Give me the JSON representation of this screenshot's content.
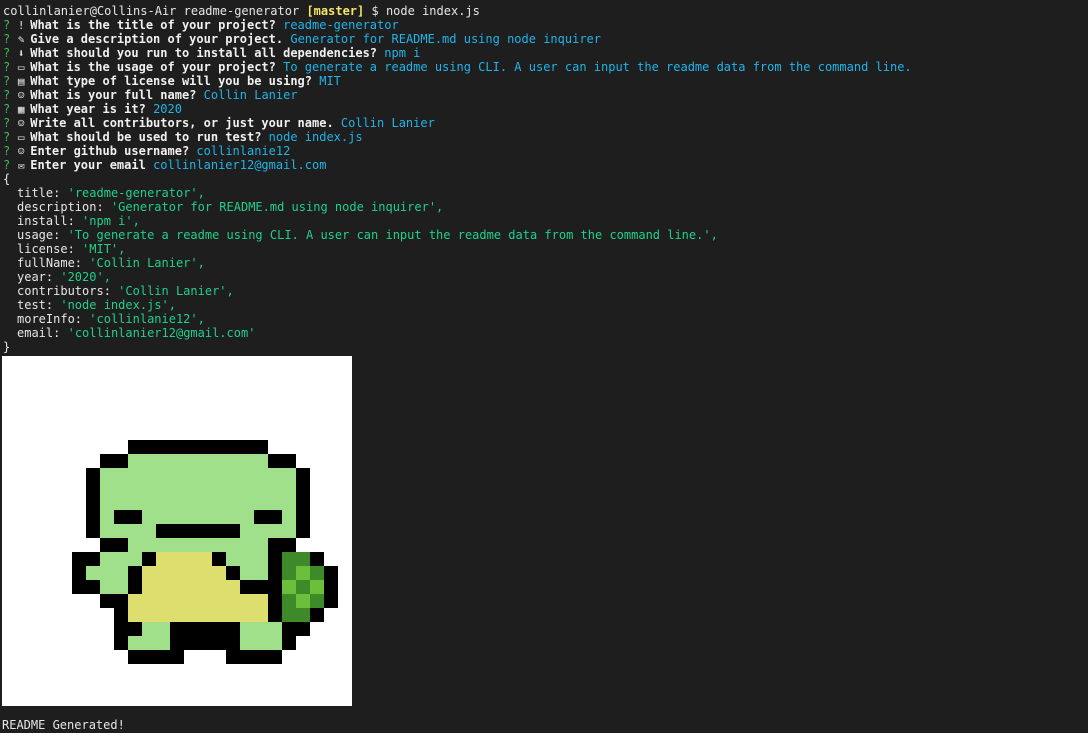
{
  "shell": {
    "prompt": "collinlanier@Collins-Air readme-generator",
    "branch": "[master]",
    "symbol": "$",
    "command": "node index.js"
  },
  "questions": [
    {
      "mark": "?",
      "icon": "exclamation-icon",
      "glyph": "!",
      "prompt": "What is the title of your project?",
      "answer": "readme-generator"
    },
    {
      "mark": "?",
      "icon": "memo-icon",
      "glyph": "✎",
      "prompt": "Give a description of your project.",
      "answer": "Generator for README.md using node inquirer"
    },
    {
      "mark": "?",
      "icon": "download-arrow-icon",
      "glyph": "⬇",
      "prompt": "What should you run to install all dependencies?",
      "answer": "npm i"
    },
    {
      "mark": "?",
      "icon": "laptop-icon",
      "glyph": "▭",
      "prompt": "What is the usage of your project?",
      "answer": "To generate a readme using CLI. A user can input the readme data from the command line."
    },
    {
      "mark": "?",
      "icon": "card-box-icon",
      "glyph": "▤",
      "prompt": "What type of license will you be using?",
      "answer": "MIT"
    },
    {
      "mark": "?",
      "icon": "person-icon",
      "glyph": "☺",
      "prompt": "What is your full name?",
      "answer": "Collin Lanier"
    },
    {
      "mark": "?",
      "icon": "calendar-icon",
      "glyph": "▦",
      "prompt": "What year is it?",
      "answer": "2020"
    },
    {
      "mark": "?",
      "icon": "person-icon",
      "glyph": "☺",
      "prompt": "Write all contributors, or just your name.",
      "answer": "Collin Lanier"
    },
    {
      "mark": "?",
      "icon": "laptop-icon",
      "glyph": "▭",
      "prompt": "What should be used to run test?",
      "answer": "node index.js"
    },
    {
      "mark": "?",
      "icon": "person-icon",
      "glyph": "☺",
      "prompt": "Enter github username?",
      "answer": "collinlanie12"
    },
    {
      "mark": "?",
      "icon": "mailbox-icon",
      "glyph": "✉",
      "prompt": "Enter your email",
      "answer": "collinlanier12@gmail.com"
    }
  ],
  "output": {
    "open_brace": "{",
    "close_brace": "}",
    "fields": [
      {
        "key": "title:",
        "value": "'readme-generator',"
      },
      {
        "key": "description:",
        "value": "'Generator for README.md using node inquirer',"
      },
      {
        "key": "install:",
        "value": "'npm i',"
      },
      {
        "key": "usage:",
        "value": "'To generate a readme using CLI. A user can input the readme data from the command line.',"
      },
      {
        "key": "license:",
        "value": "'MIT',"
      },
      {
        "key": "fullName:",
        "value": "'Collin Lanier',"
      },
      {
        "key": "year:",
        "value": "'2020',"
      },
      {
        "key": "contributors:",
        "value": "'Collin Lanier',"
      },
      {
        "key": "test:",
        "value": "'node index.js',"
      },
      {
        "key": "moreInfo:",
        "value": "'collinlanie12',"
      },
      {
        "key": "email:",
        "value": "'collinlanier12@gmail.com'"
      }
    ]
  },
  "footer": "README Generated!",
  "colors": {
    "background": "#1e1e1e",
    "answer": "#20b4e8",
    "string": "#20d08a",
    "branch": "#f5e663",
    "question_mark": "#3fb950",
    "turtle_body": "#a0e08a",
    "turtle_belly": "#dede6e",
    "turtle_shell_dark": "#3e8a2a",
    "turtle_shell_light": "#6cbf3a",
    "outline": "#000000"
  }
}
